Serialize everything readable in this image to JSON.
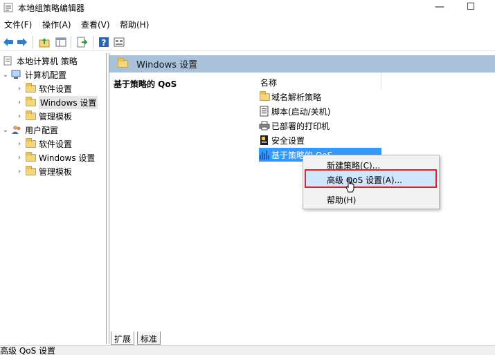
{
  "window": {
    "title": "本地组策略编辑器",
    "minimize_glyph": "—",
    "maximize_glyph": "☐"
  },
  "menu": {
    "file": "文件(F)",
    "action": "操作(A)",
    "view": "查看(V)",
    "help": "帮助(H)"
  },
  "toolbar": {
    "icons": [
      "back-arrow-icon",
      "forward-arrow-icon",
      "up-folder-icon",
      "show-hide-tree-icon",
      "export-list-icon",
      "help-icon",
      "properties-icon"
    ]
  },
  "tree": {
    "root": "本地计算机 策略",
    "computer_config": "计算机配置",
    "computer_children": [
      "软件设置",
      "Windows 设置",
      "管理模板"
    ],
    "user_config": "用户配置",
    "user_children": [
      "软件设置",
      "Windows 设置",
      "管理模板"
    ]
  },
  "right_pane": {
    "header_title": "Windows 设置",
    "description_title": "基于策略的 QoS",
    "column_name": "名称",
    "items": [
      "域名解析策略",
      "脚本(启动/关机)",
      "已部署的打印机",
      "安全设置",
      "基于策略的 QoS"
    ]
  },
  "context_menu": {
    "items": [
      "新建策略(C)...",
      "高级 QoS 设置(A)...",
      "帮助(H)"
    ]
  },
  "tabs": {
    "extended": "扩展",
    "standard": "标准"
  },
  "status": {
    "text": "高级 QoS 设置"
  },
  "colors": {
    "pane_header": "#a9c1d9",
    "selection": "#3399ff",
    "highlight_border": "#e0232a"
  }
}
